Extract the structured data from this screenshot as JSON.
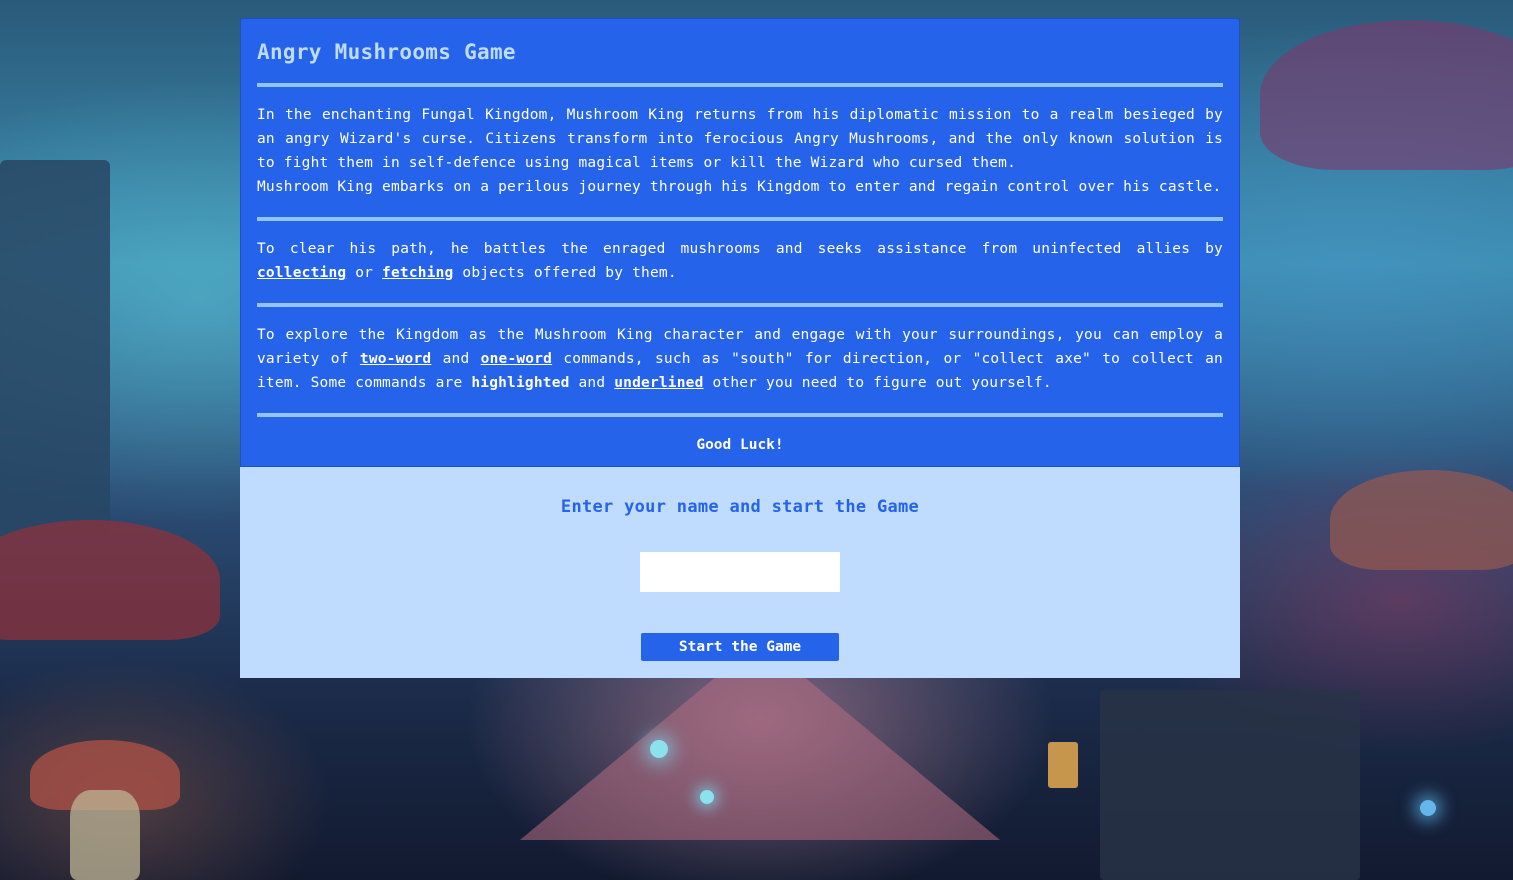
{
  "page": {
    "title": "Angry Mushrooms Game"
  },
  "intro": {
    "story_line1": "In the enchanting Fungal Kingdom, Mushroom King returns from his diplomatic mission to a realm besieged by an angry Wizard's curse. Citizens transform into ferocious Angry Mushrooms, and the only known solution is to fight them in self-defence using magical items or kill the Wizard who cursed them.",
    "story_line2": "Mushroom King embarks on a perilous journey through his Kingdom to enter and regain control over his castle.",
    "path_before": "To clear his path, he battles the enraged mushrooms and seeks assistance from uninfected allies by ",
    "path_kw1": "collecting",
    "path_mid": " or ",
    "path_kw2": "fetching",
    "path_after": " objects offered by them.",
    "explore_before": "To explore the Kingdom as the Mushroom King character and engage with your surroundings, you can employ a variety of ",
    "explore_kw1": "two-word",
    "explore_and": " and ",
    "explore_kw2": "one-word",
    "explore_mid": " commands, such as \"south\" for direction, or \"collect axe\" to collect an item. Some commands are ",
    "explore_hl": "highlighted",
    "explore_and2": " and ",
    "explore_ul": "underlined",
    "explore_after": " other you need to figure out yourself.",
    "good_luck": "Good Luck!"
  },
  "start": {
    "heading": "Enter your name and start the Game",
    "name_value": "",
    "button_label": "Start the Game"
  },
  "colors": {
    "panel_blue": "#2563eb",
    "title_light": "#bfdbfe",
    "rule": "#93c5fd",
    "start_bg": "#bfdbfe"
  }
}
